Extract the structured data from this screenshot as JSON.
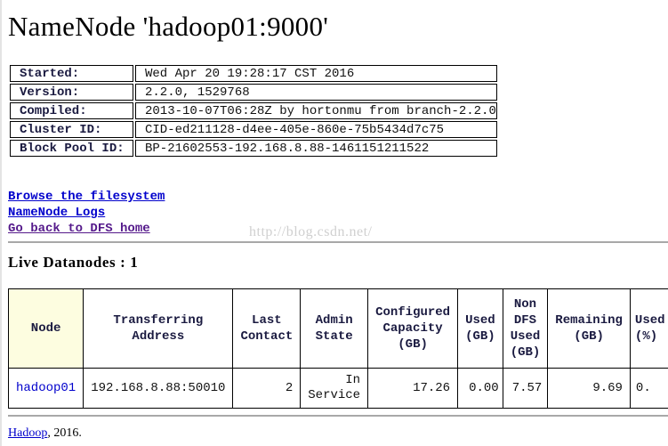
{
  "title": "NameNode 'hadoop01:9000'",
  "info": [
    {
      "label": "Started:",
      "value": "Wed Apr 20 19:28:17 CST 2016"
    },
    {
      "label": "Version:",
      "value": "2.2.0, 1529768"
    },
    {
      "label": "Compiled:",
      "value": "2013-10-07T06:28Z by hortonmu from branch-2.2.0"
    },
    {
      "label": "Cluster ID:",
      "value": "CID-ed211128-d4ee-405e-860e-75b5434d7c75"
    },
    {
      "label": "Block Pool ID:",
      "value": "BP-21602553-192.168.8.88-1461151211522"
    }
  ],
  "links": {
    "browse": "Browse the filesystem",
    "logs": "NameNode Logs",
    "home": "Go back to DFS home"
  },
  "watermark": "http://blog.csdn.net/",
  "live_heading": "Live Datanodes : 1",
  "table": {
    "headers": [
      "Node",
      "Transferring Address",
      "Last Contact",
      "Admin State",
      "Configured Capacity (GB)",
      "Used (GB)",
      "Non DFS Used (GB)",
      "Remaining (GB)",
      "Used (%)"
    ],
    "rows": [
      {
        "node": "hadoop01",
        "address": "192.168.8.88:50010",
        "last_contact": "2",
        "admin_state": "In Service",
        "capacity": "17.26",
        "used": "0.00",
        "non_dfs_used": "7.57",
        "remaining": "9.69",
        "used_pct": "0."
      }
    ]
  },
  "footer": {
    "link": "Hadoop",
    "text": ", 2016."
  }
}
